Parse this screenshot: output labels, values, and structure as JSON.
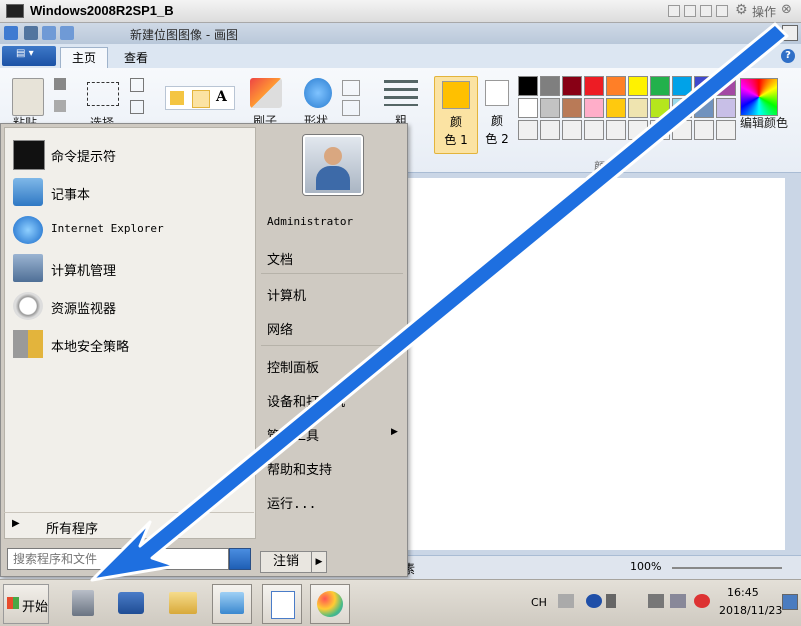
{
  "vm": {
    "title": "Windows2008R2SP1_B",
    "ops_label": "操作",
    "close_glyph": "⊗",
    "settings_glyph": "⚙"
  },
  "paint": {
    "title": "新建位图图像 - 画图",
    "file_menu_glyph": "▤ ▾",
    "tabs": [
      {
        "label": "主页"
      },
      {
        "label": "查看"
      }
    ],
    "help_glyph": "?",
    "groups": {
      "paste_label": "粘贴",
      "select_label": "选择",
      "brush_label": "刷子",
      "shapes_label": "形状",
      "size_label": "粗",
      "color1_label": "颜\n色 1",
      "color2_label": "颜\n色 2",
      "palette_group_label": "颜色",
      "edit_colors_label": "编辑颜色"
    },
    "palette": [
      "#000000",
      "#7f7f7f",
      "#880015",
      "#ed1c24",
      "#ff7f27",
      "#fff200",
      "#22b14c",
      "#00a2e8",
      "#3f48cc",
      "#a349a4",
      "#ffffff",
      "#c3c3c3",
      "#b97a57",
      "#ffaec9",
      "#ffc90e",
      "#efe4b0",
      "#b5e61d",
      "#99d9ea",
      "#7092be",
      "#c8bfe7",
      "#f0f0f0",
      "#f0f0f0",
      "#f0f0f0",
      "#f0f0f0",
      "#f0f0f0",
      "#f0f0f0",
      "#f0f0f0",
      "#f0f0f0",
      "#f0f0f0",
      "#f0f0f0"
    ],
    "color1_value": "#ffc000",
    "color2_value": "#ffffff",
    "status": {
      "pixels_label": "素",
      "zoom_label": "100%"
    }
  },
  "start_menu": {
    "programs": [
      {
        "label": "命令提示符",
        "icon": "cmd-icon"
      },
      {
        "label": "记事本",
        "icon": "notepad-icon"
      },
      {
        "label": "Internet Explorer",
        "icon": "ie-icon"
      },
      {
        "label": "计算机管理",
        "icon": "computer-management-icon"
      },
      {
        "label": "资源监视器",
        "icon": "resource-monitor-icon"
      },
      {
        "label": "本地安全策略",
        "icon": "security-policy-icon"
      }
    ],
    "all_programs_label": "所有程序",
    "search_placeholder": "搜索程序和文件",
    "right_items": {
      "user": "Administrator",
      "documents": "文档",
      "computer": "计算机",
      "network": "网络",
      "control_panel": "控制面板",
      "devices": "设备和打印机",
      "admin_tools": "管理工具",
      "help": "帮助和支持",
      "run": "运行..."
    },
    "logoff_label": "注销",
    "logoff_arrow": "▶"
  },
  "taskbar": {
    "start_label": "开始",
    "language": "CH",
    "time": "16:45",
    "date": "2018/11/23"
  },
  "colors": {
    "arrow": "#1e6fe0",
    "menu_bg": "#cfcac2",
    "ribbon_bg": "#e7edf5"
  }
}
